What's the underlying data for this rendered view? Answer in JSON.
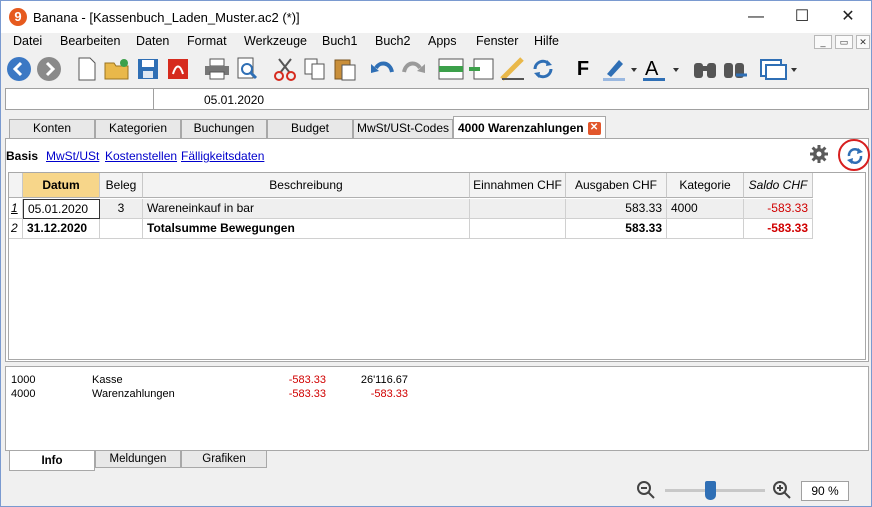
{
  "window": {
    "title": "Banana - [Kassenbuch_Laden_Muster.ac2 (*)]",
    "minimize": "—",
    "maximize": "☐",
    "close": "✕"
  },
  "menu": [
    "Datei",
    "Bearbeiten",
    "Daten",
    "Format",
    "Werkzeuge",
    "Buch1",
    "Buch2",
    "Apps",
    "Fenster",
    "Hilfe"
  ],
  "cellbar": {
    "value": "05.01.2020"
  },
  "tabs": [
    "Konten",
    "Kategorien",
    "Buchungen",
    "Budget",
    "MwSt/USt-Codes",
    "4000 Warenzahlungen"
  ],
  "views": [
    "Basis",
    "MwSt/USt",
    "Kostenstellen",
    "Fälligkeitsdaten"
  ],
  "table": {
    "headers": [
      "Datum",
      "Beleg",
      "Beschreibung",
      "Einnahmen CHF",
      "Ausgaben CHF",
      "Kategorie",
      "Saldo CHF"
    ],
    "rows": [
      {
        "num": "1",
        "datum": "05.01.2020",
        "beleg": "3",
        "beschreibung": "Wareneinkauf in bar",
        "einnahmen": "",
        "ausgaben": "583.33",
        "kategorie": "4000",
        "saldo": "-583.33"
      },
      {
        "num": "2",
        "datum": "31.12.2020",
        "beleg": "",
        "beschreibung": "Totalsumme Bewegungen",
        "einnahmen": "",
        "ausgaben": "583.33",
        "kategorie": "",
        "saldo": "-583.33"
      }
    ]
  },
  "info": {
    "rows": [
      {
        "konto": "1000",
        "name": "Kasse",
        "betrag": "-583.33",
        "saldo": "26'116.67"
      },
      {
        "konto": "4000",
        "name": "Warenzahlungen",
        "betrag": "-583.33",
        "saldo": "-583.33"
      }
    ]
  },
  "bottom_tabs": [
    "Info",
    "Meldungen",
    "Grafiken"
  ],
  "zoom": {
    "value": "90 %",
    "level_percent": 90
  },
  "colors": {
    "negative": "#d00000",
    "accent": "#2f6fb5",
    "highlight_circle": "#d71f1f"
  }
}
